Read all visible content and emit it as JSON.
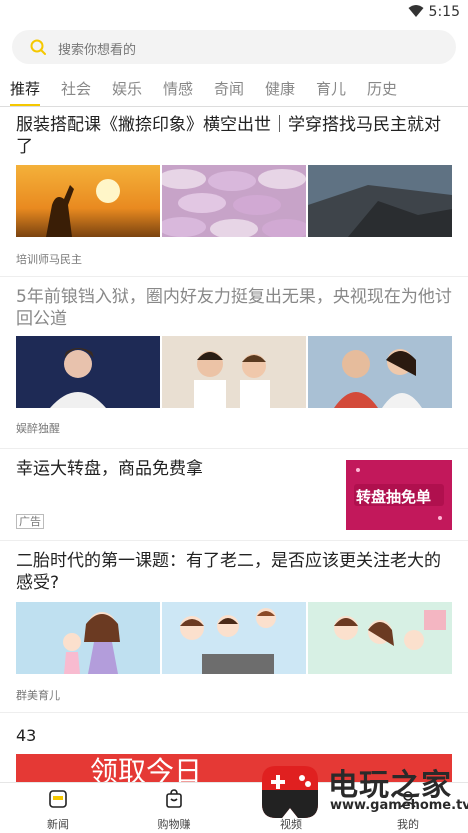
{
  "status_bar": {
    "time": "5:15"
  },
  "search": {
    "placeholder": "搜索你想看的"
  },
  "tabs": [
    {
      "label": "推荐",
      "active": true
    },
    {
      "label": "社会"
    },
    {
      "label": "娱乐"
    },
    {
      "label": "情感"
    },
    {
      "label": "奇闻"
    },
    {
      "label": "健康"
    },
    {
      "label": "育儿"
    },
    {
      "label": "历史"
    }
  ],
  "articles": [
    {
      "title": "服装搭配课《撇捺印象》横空出世｜学穿搭找马民主就对了",
      "source": "培训师马民主",
      "read": false
    },
    {
      "title": "5年前锒铛入狱，圈内好友力挺复出无果，央视现在为他讨回公道",
      "source": "娱醉独醒",
      "read": true
    },
    {
      "title": "二胎时代的第一课题：有了老二，是否应该更关注老大的感受?",
      "source": "群美育儿",
      "read": false
    }
  ],
  "ad": {
    "title": "幸运大转盘，商品免费拿",
    "badge": "广告",
    "image_text": "转盘抽免单"
  },
  "partial_item": {
    "number": "43",
    "banner_text": "领取今日"
  },
  "bottom_nav": [
    {
      "label": "新闻",
      "icon": "news-icon"
    },
    {
      "label": "购物赚",
      "icon": "shopping-bag-icon"
    },
    {
      "label": "视频",
      "icon": "video-icon"
    },
    {
      "label": "我的",
      "icon": "profile-icon"
    }
  ],
  "watermark": {
    "title": "电玩之家",
    "url": "www.gamehome.tv"
  },
  "colors": {
    "accent": "#f5c800",
    "ad_image": "#c2185b",
    "banner": "#e53935"
  }
}
